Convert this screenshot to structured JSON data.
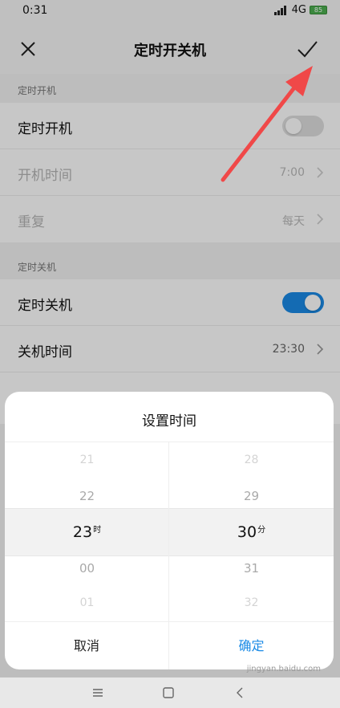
{
  "status": {
    "time": "0:31",
    "network": "4G",
    "battery": "85"
  },
  "header": {
    "title": "定时开关机"
  },
  "power_on": {
    "section_label": "定时开机",
    "toggle_label": "定时开机",
    "time_label": "开机时间",
    "time_value": "7:00",
    "repeat_label": "重复",
    "repeat_value": "每天"
  },
  "power_off": {
    "section_label": "定时关机",
    "toggle_label": "定时关机",
    "time_label": "关机时间",
    "time_value": "23:30"
  },
  "dialog": {
    "title": "设置时间",
    "hours": {
      "far_above": "21",
      "above": "22",
      "selected": "23",
      "unit": "时",
      "below": "00",
      "far_below": "01"
    },
    "minutes": {
      "far_above": "28",
      "above": "29",
      "selected": "30",
      "unit": "分",
      "below": "31",
      "far_below": "32"
    },
    "cancel_label": "取消",
    "confirm_label": "确定"
  },
  "watermark": "jingyan.baidu.com",
  "colors": {
    "accent": "#1a8ae6",
    "arrow": "#f04848"
  }
}
